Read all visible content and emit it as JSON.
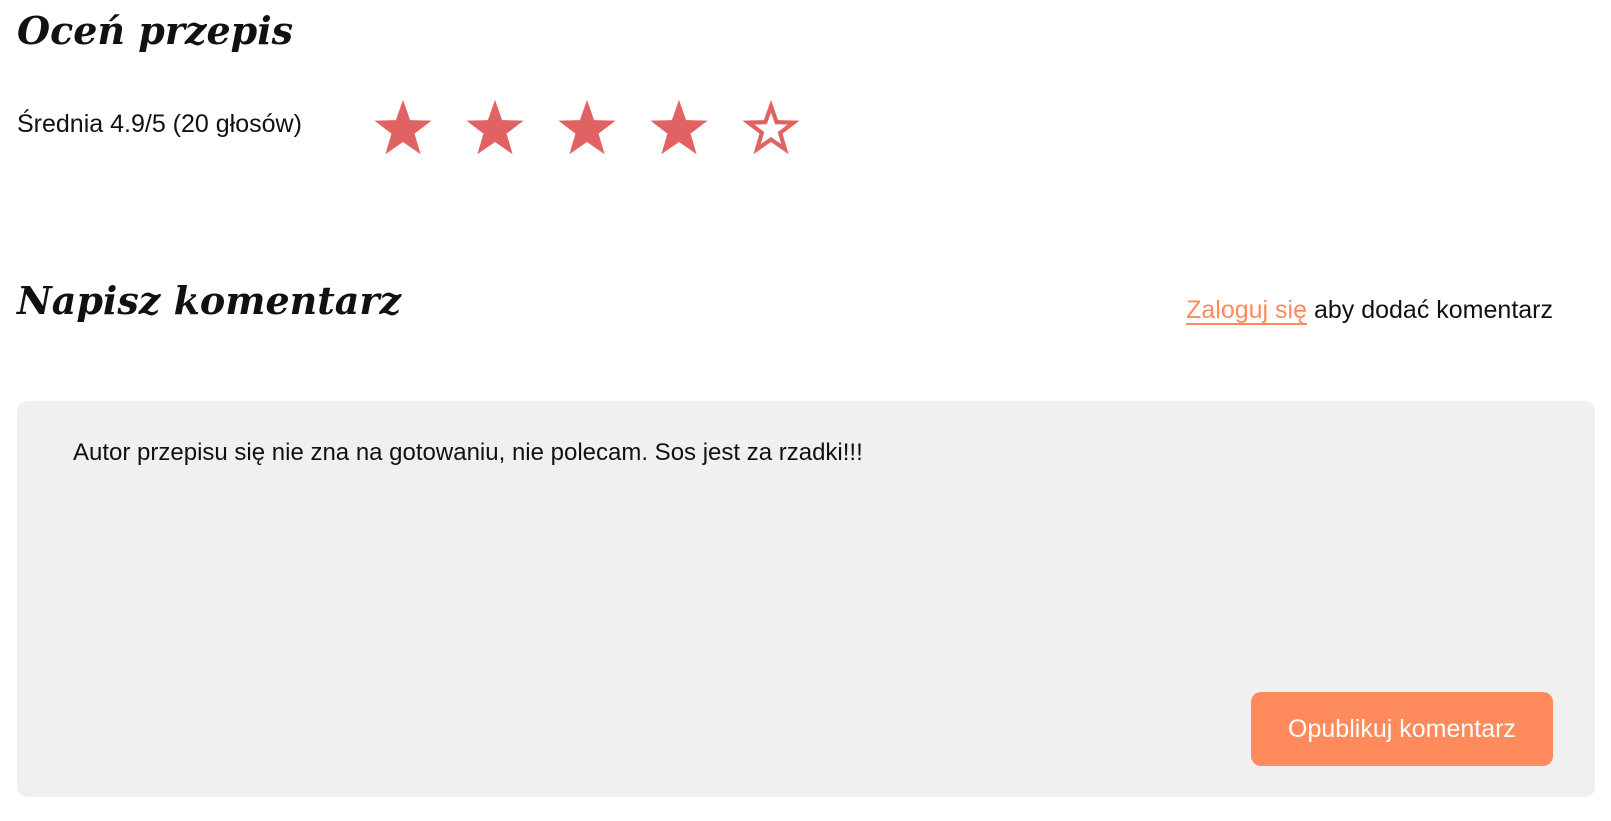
{
  "rating": {
    "heading": "Oceń przepis",
    "average_text": "Średnia 4.9/5 (20 głosów)",
    "stars_filled": 4,
    "stars_total": 5,
    "star_color": "#e06262"
  },
  "comment": {
    "heading": "Napisz komentarz",
    "login_link": "Zaloguj się",
    "login_suffix": " aby dodać komentarz",
    "text_value": "Autor przepisu się nie zna na gotowaniu, nie polecam. Sos jest za rzadki!!!",
    "publish_label": "Opublikuj komentarz",
    "accent_color": "#ff8a5c",
    "box_color": "#f0f0f0"
  }
}
